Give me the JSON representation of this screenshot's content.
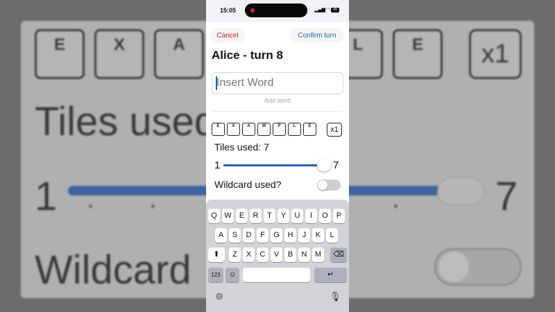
{
  "background": {
    "tiles": [
      "E",
      "X",
      "A",
      "",
      "L",
      "E"
    ],
    "multiplier": "x1",
    "tiles_used_text": "Tiles used",
    "slider_min": "1",
    "slider_max": "7",
    "wildcard_text": "Wildcard"
  },
  "status_bar": {
    "time": "15:05",
    "battery": "49"
  },
  "sheet": {
    "cancel_label": "Cancel",
    "confirm_label": "Confirm turn",
    "title": "Alice - turn 8",
    "word_input_placeholder": "Insert Word",
    "add_word_label": "Add word",
    "tiles": [
      "E",
      "X",
      "A",
      "M",
      "P",
      "L",
      "E"
    ],
    "multiplier": "x1",
    "tiles_used_label": "Tiles used: 7",
    "tiles_used_value": 7,
    "slider_min": "1",
    "slider_max": "7",
    "wildcard_label": "Wildcard used?",
    "wildcard_on": false
  },
  "keyboard": {
    "row1": [
      "Q",
      "W",
      "E",
      "R",
      "T",
      "Y",
      "U",
      "I",
      "O",
      "P"
    ],
    "row2": [
      "A",
      "S",
      "D",
      "F",
      "G",
      "H",
      "J",
      "K",
      "L"
    ],
    "row3": [
      "Z",
      "X",
      "C",
      "V",
      "B",
      "N",
      "M"
    ],
    "numbers_key": "123",
    "shift_icon": "shift-icon",
    "delete_icon": "delete-icon",
    "emoji_icon": "emoji-icon",
    "return_icon": "return-icon",
    "globe_icon": "globe-icon",
    "mic_icon": "microphone-icon"
  },
  "colors": {
    "accent": "#1560c4",
    "cancel": "#b3261e",
    "slider": "#1d5fc7"
  }
}
